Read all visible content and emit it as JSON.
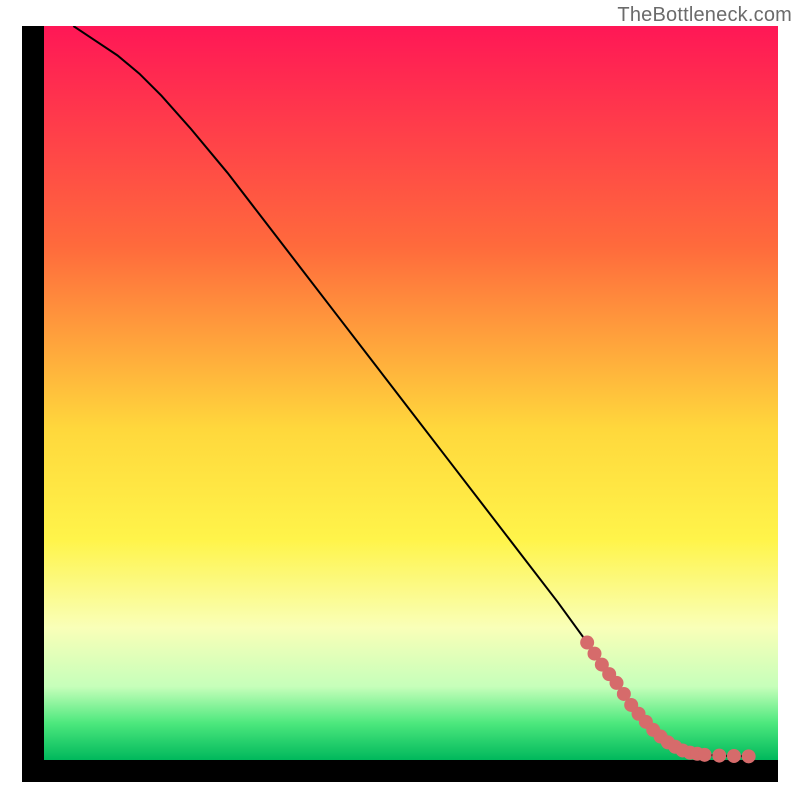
{
  "attribution": "TheBottleneck.com",
  "chart_data": {
    "type": "line",
    "title": "",
    "xlabel": "",
    "ylabel": "",
    "xlim": [
      0,
      100
    ],
    "ylim": [
      0,
      100
    ],
    "gradient_stops": [
      {
        "offset": 0,
        "color": "#ff1756"
      },
      {
        "offset": 30,
        "color": "#ff6a3c"
      },
      {
        "offset": 55,
        "color": "#ffd83c"
      },
      {
        "offset": 70,
        "color": "#fff44a"
      },
      {
        "offset": 82,
        "color": "#f9ffb8"
      },
      {
        "offset": 90,
        "color": "#c6ffba"
      },
      {
        "offset": 95,
        "color": "#4ce87d"
      },
      {
        "offset": 100,
        "color": "#00b85c"
      }
    ],
    "series": [
      {
        "name": "curve",
        "x": [
          4,
          7,
          10,
          13,
          16,
          20,
          25,
          30,
          35,
          40,
          45,
          50,
          55,
          60,
          65,
          70,
          74,
          78,
          80,
          82,
          84,
          86,
          88,
          90,
          92,
          94,
          96
        ],
        "values": [
          100,
          98,
          96,
          93.5,
          90.5,
          86,
          80,
          73.5,
          67,
          60.5,
          54,
          47.5,
          41,
          34.5,
          28,
          21.5,
          16,
          10.5,
          7.5,
          5.2,
          3.2,
          1.8,
          1.0,
          0.7,
          0.6,
          0.55,
          0.5
        ]
      }
    ],
    "markers": {
      "name": "highlight-points",
      "color": "#d66b6b",
      "x": [
        74,
        75,
        76,
        77,
        78,
        79,
        80,
        81,
        82,
        83,
        84,
        85,
        86,
        87,
        88,
        89,
        90,
        92,
        94,
        96
      ],
      "values": [
        16,
        14.5,
        13,
        11.7,
        10.5,
        9,
        7.5,
        6.3,
        5.2,
        4.1,
        3.2,
        2.4,
        1.8,
        1.3,
        1.0,
        0.85,
        0.7,
        0.6,
        0.55,
        0.5
      ]
    }
  }
}
